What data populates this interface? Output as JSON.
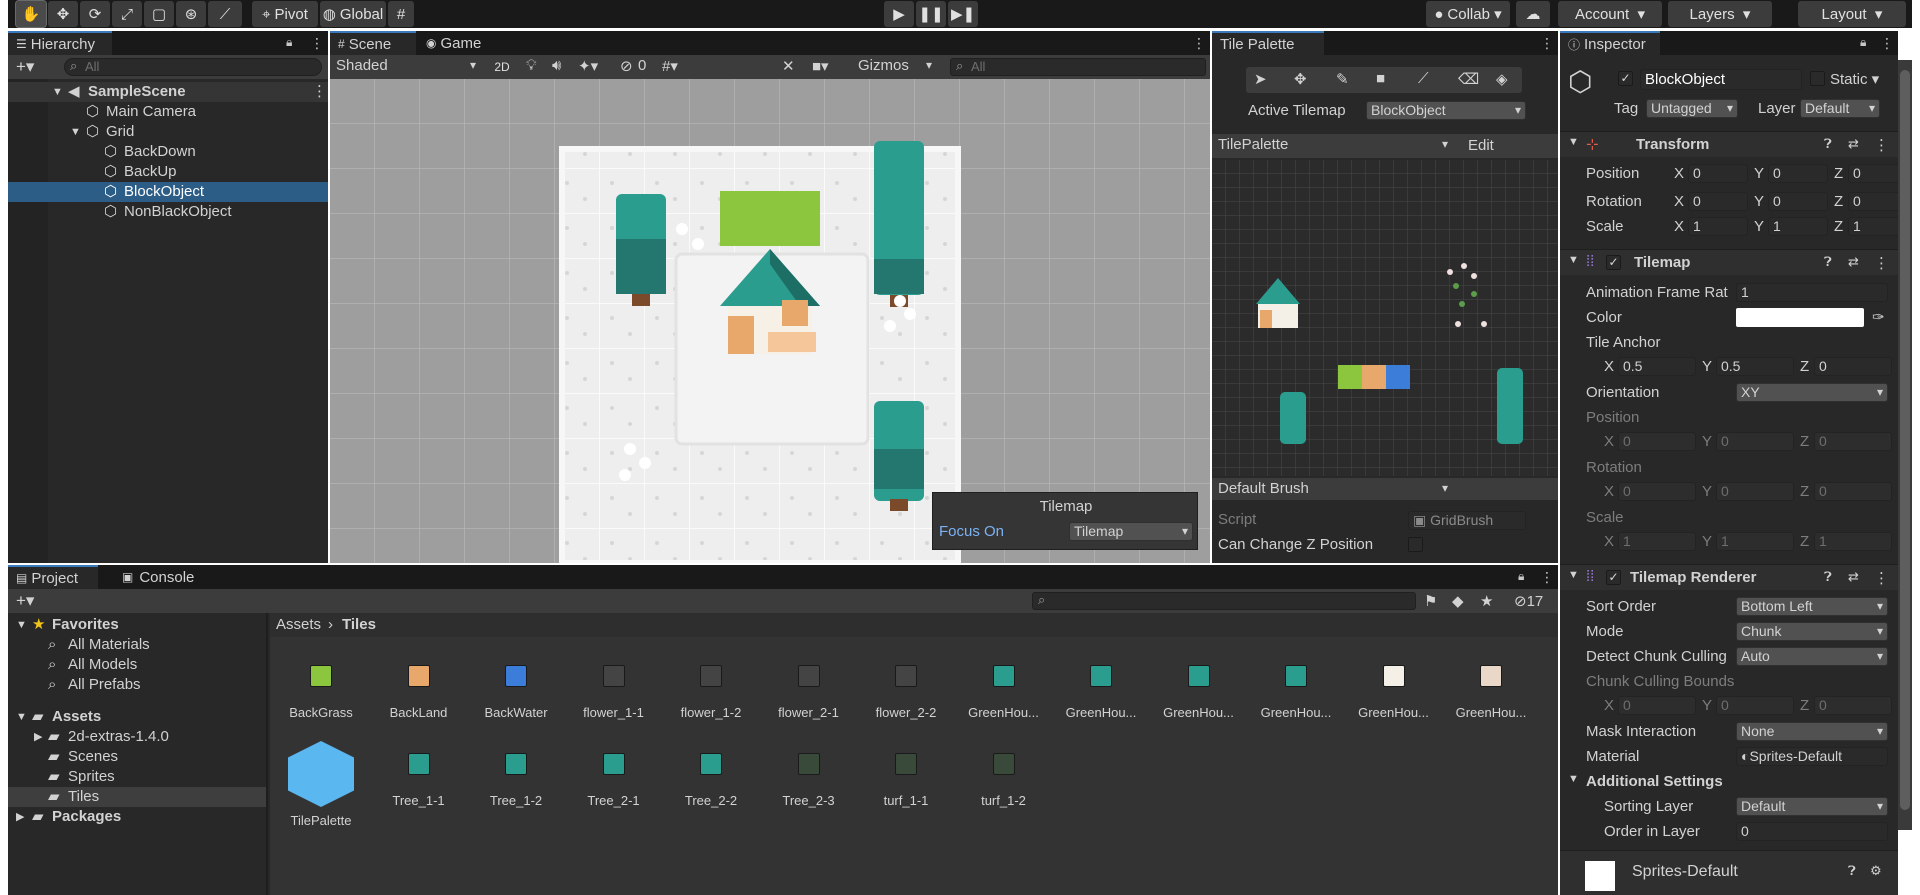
{
  "toolbar": {
    "pivot": "Pivot",
    "global": "Global",
    "collab": "Collab",
    "account": "Account",
    "layers": "Layers",
    "layout": "Layout"
  },
  "hierarchy": {
    "tab": "Hierarchy",
    "search_placeholder": "All",
    "scene": "SampleScene",
    "items": [
      "Main Camera",
      "Grid",
      "BackDown",
      "BackUp",
      "BlockObject",
      "NonBlackObject"
    ]
  },
  "scene_view": {
    "tabs": [
      "Scene",
      "Game"
    ],
    "shading": "Shaded",
    "mode_2d": "2D",
    "hidden_count": "0",
    "gizmos": "Gizmos",
    "search_placeholder": "All",
    "overlay_title": "Tilemap",
    "focus_label": "Focus On",
    "focus_value": "Tilemap"
  },
  "tile_palette": {
    "tab": "Tile Palette",
    "active_tilemap_label": "Active Tilemap",
    "active_tilemap_value": "BlockObject",
    "palette_name": "TilePalette",
    "edit": "Edit",
    "brush": "Default Brush",
    "script_label": "Script",
    "script_value": "GridBrush",
    "z_label": "Can Change Z Position"
  },
  "inspector": {
    "tab": "Inspector",
    "object_name": "BlockObject",
    "static_label": "Static",
    "tag_label": "Tag",
    "tag_value": "Untagged",
    "layer_label": "Layer",
    "layer_value": "Default",
    "transform": {
      "title": "Transform",
      "position_label": "Position",
      "rotation_label": "Rotation",
      "scale_label": "Scale",
      "position": [
        "0",
        "0",
        "0"
      ],
      "rotation": [
        "0",
        "0",
        "0"
      ],
      "scale": [
        "1",
        "1",
        "1"
      ]
    },
    "tilemap": {
      "title": "Tilemap",
      "anim_label": "Animation Frame Rat",
      "anim_value": "1",
      "color_label": "Color",
      "anchor_label": "Tile Anchor",
      "anchor": [
        "0.5",
        "0.5",
        "0"
      ],
      "orientation_label": "Orientation",
      "orientation_value": "XY",
      "position_label": "Position",
      "rotation_label": "Rotation",
      "scale_label": "Scale",
      "position": [
        "0",
        "0",
        "0"
      ],
      "rotation": [
        "0",
        "0",
        "0"
      ],
      "scale": [
        "1",
        "1",
        "1"
      ]
    },
    "renderer": {
      "title": "Tilemap Renderer",
      "sort_label": "Sort Order",
      "sort_value": "Bottom Left",
      "mode_label": "Mode",
      "mode_value": "Chunk",
      "detect_label": "Detect Chunk Culling",
      "detect_value": "Auto",
      "bounds_label": "Chunk Culling Bounds",
      "bounds": [
        "0",
        "0",
        "0"
      ],
      "mask_label": "Mask Interaction",
      "mask_value": "None",
      "material_label": "Material",
      "material_value": "Sprites-Default",
      "additional_label": "Additional Settings",
      "sorting_layer_label": "Sorting Layer",
      "sorting_layer_value": "Default",
      "order_label": "Order in Layer",
      "order_value": "0"
    },
    "material_footer": "Sprites-Default"
  },
  "project": {
    "tabs": [
      "Project",
      "Console"
    ],
    "hidden_count": "17",
    "favorites_label": "Favorites",
    "favorites": [
      "All Materials",
      "All Models",
      "All Prefabs"
    ],
    "assets_label": "Assets",
    "asset_folders": [
      "2d-extras-1.4.0",
      "Scenes",
      "Sprites",
      "Tiles"
    ],
    "packages_label": "Packages",
    "breadcrumb_root": "Assets",
    "breadcrumb_current": "Tiles",
    "assets_row1": [
      "BackGrass",
      "BackLand",
      "BackWater",
      "flower_1-1",
      "flower_1-2",
      "flower_2-1",
      "flower_2-2",
      "GreenHou...",
      "GreenHou...",
      "GreenHou...",
      "GreenHou...",
      "GreenHou...",
      "GreenHou..."
    ],
    "assets_row2": [
      "TilePalette",
      "Tree_1-1",
      "Tree_1-2",
      "Tree_2-1",
      "Tree_2-2",
      "Tree_2-3",
      "turf_1-1",
      "turf_1-2"
    ]
  },
  "colors": {
    "accent": "#2c5d87",
    "panel": "#282828",
    "grass": "#8cc63f",
    "tree": "#2a9d8f",
    "water": "#3b7dd8",
    "land": "#e9a86b"
  }
}
